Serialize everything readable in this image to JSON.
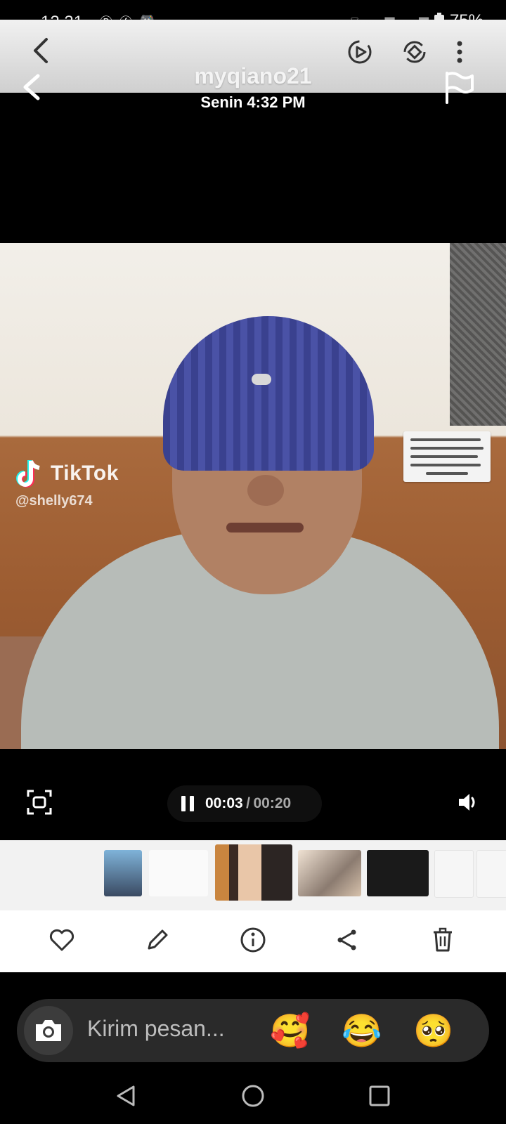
{
  "status_bar": {
    "time": "12.31",
    "battery": "75%",
    "left_icons": [
      "b-badge-icon",
      "facebook-icon",
      "game-controller-icon"
    ],
    "right_icons": [
      "wifi-icon",
      "signal-icon",
      "signal-icon",
      "battery-icon"
    ]
  },
  "story": {
    "username": "myqiano21",
    "timestamp": "Senin 4:32 PM"
  },
  "video": {
    "watermark_brand": "TikTok",
    "watermark_handle": "@shelly674",
    "current_time": "00:03",
    "separator": "/",
    "duration": "00:20",
    "progress_fraction": 0.15
  },
  "actions": [
    "favorite",
    "edit",
    "info",
    "share",
    "delete"
  ],
  "message": {
    "placeholder": "Kirim pesan...",
    "quick_reactions": [
      "🥰",
      "😂",
      "🥺"
    ]
  },
  "colors": {
    "beanie": "#3f469a",
    "shirt": "#b7bcb8",
    "message_bar": "#2a2a2a"
  }
}
